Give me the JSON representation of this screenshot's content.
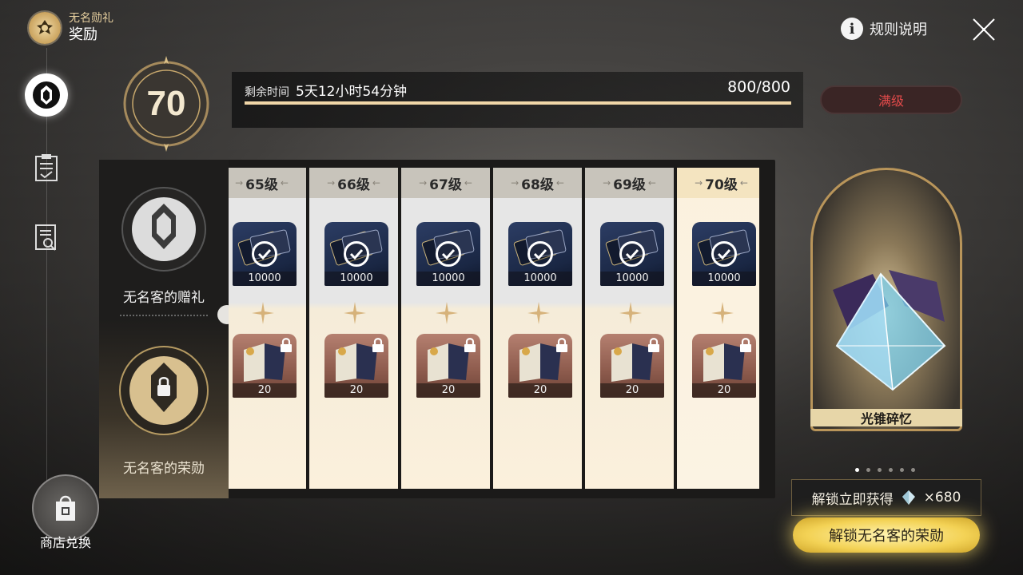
{
  "header": {
    "subtitle": "无名勋礼",
    "title": "奖励",
    "rules_label": "规则说明"
  },
  "sidebar": {
    "tabs": [
      {
        "icon": "emblem-icon",
        "active": true
      },
      {
        "icon": "clipboard-icon",
        "active": false
      },
      {
        "icon": "document-search-icon",
        "active": false
      }
    ],
    "shop_label": "商店兑换"
  },
  "level": {
    "value": "70",
    "remaining_label": "剩余时间",
    "remaining_time": "5天12小时54分钟",
    "exp_text": "800/800",
    "exp_fraction": 1.0,
    "max_label": "满级"
  },
  "tracks": {
    "free_label": "无名客的赠礼",
    "paid_label": "无名客的荣勋"
  },
  "levels": [
    {
      "label": "65级",
      "free_qty": "10000",
      "paid_qty": "20",
      "current": false
    },
    {
      "label": "66级",
      "free_qty": "10000",
      "paid_qty": "20",
      "current": false
    },
    {
      "label": "67级",
      "free_qty": "10000",
      "paid_qty": "20",
      "current": false
    },
    {
      "label": "68级",
      "free_qty": "10000",
      "paid_qty": "20",
      "current": false
    },
    {
      "label": "69级",
      "free_qty": "10000",
      "paid_qty": "20",
      "current": false
    },
    {
      "label": "70级",
      "free_qty": "10000",
      "paid_qty": "20",
      "current": true
    }
  ],
  "showcase": {
    "name": "光锥碎忆",
    "pages": 6,
    "active_page": 1
  },
  "unlock": {
    "note_label": "解锁立即获得",
    "note_amount": "×680",
    "button_label": "解锁无名客的荣勋"
  },
  "colors": {
    "accent_gold": "#e7d6a8",
    "max_red": "#e14a4a",
    "button_yellow": "#f3d255"
  }
}
